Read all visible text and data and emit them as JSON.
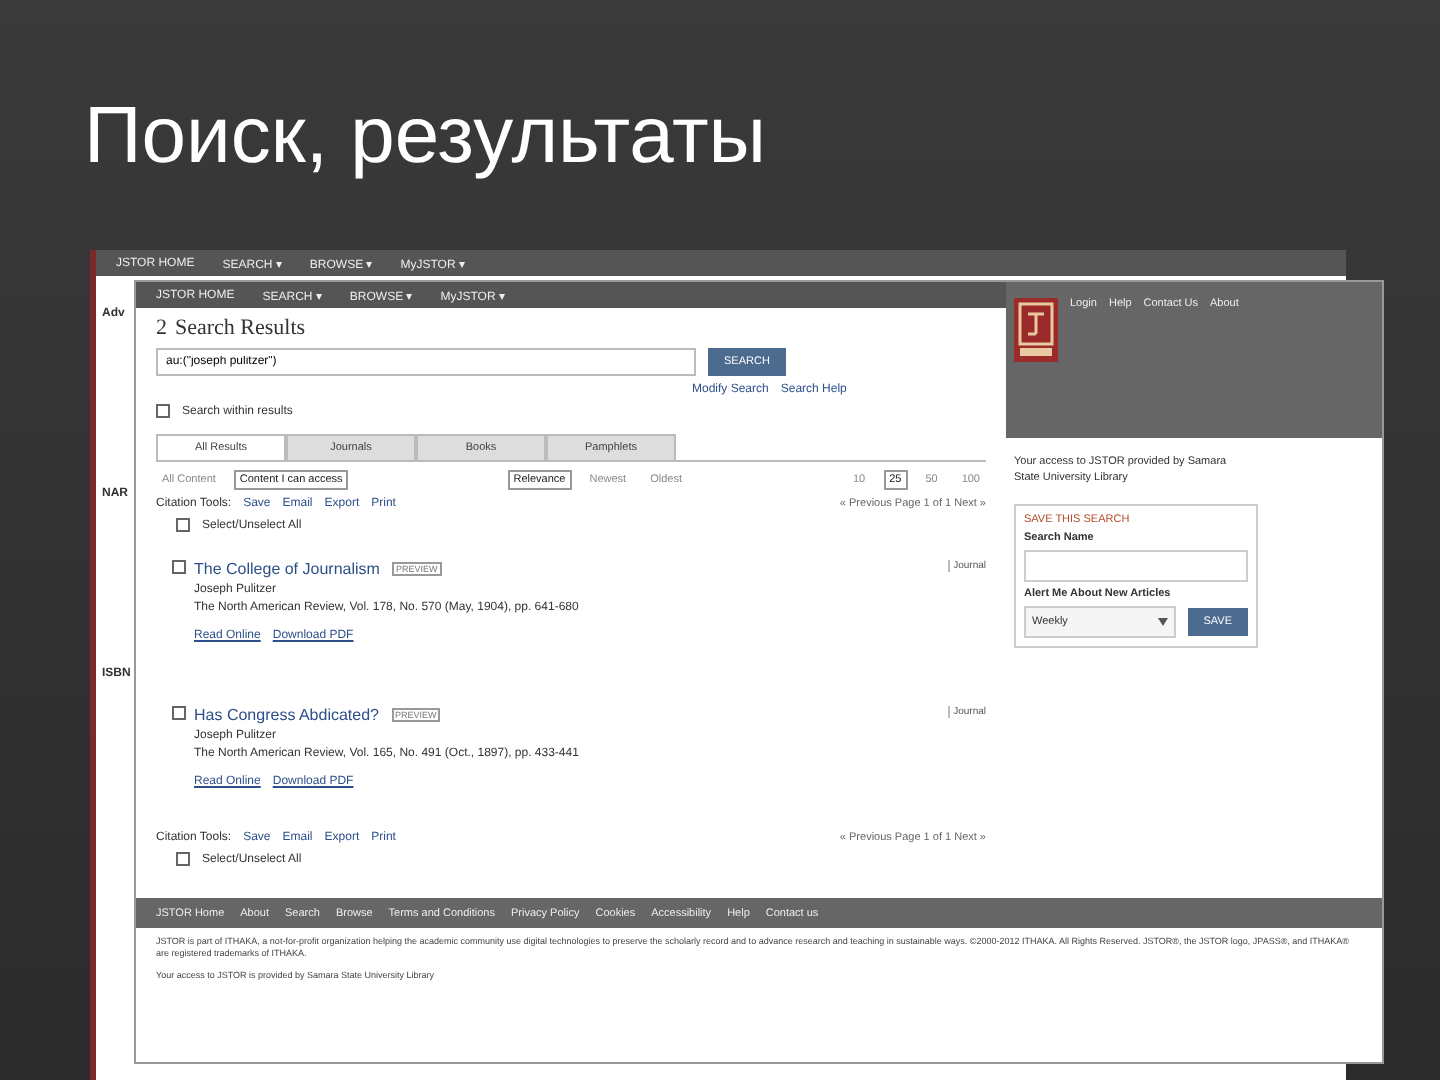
{
  "slide": {
    "title": "Поиск, результаты"
  },
  "back_window": {
    "nav": [
      "JSTOR HOME",
      "SEARCH ▾",
      "BROWSE ▾",
      "MyJSTOR ▾"
    ],
    "fragments": [
      "Adv",
      "NAR",
      "ISBN"
    ]
  },
  "window": {
    "nav": [
      "JSTOR HOME",
      "SEARCH ▾",
      "BROWSE ▾",
      "MyJSTOR ▾"
    ],
    "count": "2",
    "heading": "Search Results",
    "search": {
      "value": "au:(\"joseph pulitzer\")",
      "button": "SEARCH"
    },
    "links": [
      "Modify Search",
      "Search Help"
    ],
    "within": {
      "label": "Search within results",
      "checked": false
    },
    "tabs": [
      {
        "label": "All Results",
        "selected": true
      },
      {
        "label": "Journals",
        "selected": false
      },
      {
        "label": "Books",
        "selected": false
      },
      {
        "label": "Pamphlets",
        "selected": false
      }
    ],
    "filters": [
      {
        "label": "All Content",
        "selected": false
      },
      {
        "label": "Content I can access",
        "selected": true
      }
    ],
    "sort": [
      {
        "label": "Relevance",
        "selected": true
      },
      {
        "label": "Newest",
        "selected": false
      },
      {
        "label": "Oldest",
        "selected": false
      }
    ],
    "page_sizes": [
      {
        "label": "10",
        "selected": false
      },
      {
        "label": "25",
        "selected": true
      },
      {
        "label": "50",
        "selected": false
      },
      {
        "label": "100",
        "selected": false
      }
    ],
    "toolbars": [
      {
        "label": "Citation Tools:",
        "items": [
          "Save",
          "Email",
          "Export",
          "Print"
        ],
        "select_all": "Select/Unselect All",
        "select_all_checked": false,
        "pager": "« Previous Page 1 of 1 Next »"
      },
      {
        "label": "Citation Tools:",
        "items": [
          "Save",
          "Email",
          "Export",
          "Print"
        ],
        "select_all": "Select/Unselect All",
        "select_all_checked": false,
        "pager": "« Previous Page 1 of 1 Next »"
      }
    ],
    "results": [
      {
        "title": "The College of Journalism",
        "badge": "PREVIEW",
        "author": "Joseph Pulitzer",
        "source": "The North American Review, Vol. 178, No. 570 (May, 1904), pp. 641-680",
        "links": [
          "Read Online",
          "Download PDF"
        ],
        "type": "Journal",
        "checked": false
      },
      {
        "title": "Has Congress Abdicated?",
        "badge": "PREVIEW",
        "author": "Joseph Pulitzer",
        "source": "The North American Review, Vol. 165, No. 491 (Oct., 1897), pp. 433-441",
        "links": [
          "Read Online",
          "Download PDF"
        ],
        "type": "Journal",
        "checked": false
      }
    ],
    "header_links": [
      "Login",
      "Help",
      "Contact Us",
      "About"
    ],
    "access_note": "Your access to JSTOR provided by Samara State University Library",
    "save_search": {
      "title": "SAVE THIS SEARCH",
      "name_label": "Search Name",
      "alert_label": "Alert Me About New Articles",
      "frequency": "Weekly",
      "button": "SAVE"
    },
    "footer_links": [
      "JSTOR Home",
      "About",
      "Search",
      "Browse",
      "Terms and Conditions",
      "Privacy Policy",
      "Cookies",
      "Accessibility",
      "Help",
      "Contact us"
    ],
    "footer_text": [
      "JSTOR is part of ITHAKA, a not-for-profit organization helping the academic community use digital technologies to preserve the scholarly record and to advance research and teaching in sustainable ways. ©2000-2012 ITHAKA. All Rights Reserved. JSTOR®, the JSTOR logo, JPASS®, and ITHAKA® are registered trademarks of ITHAKA.",
      "Your access to JSTOR is provided by Samara State University Library"
    ]
  }
}
